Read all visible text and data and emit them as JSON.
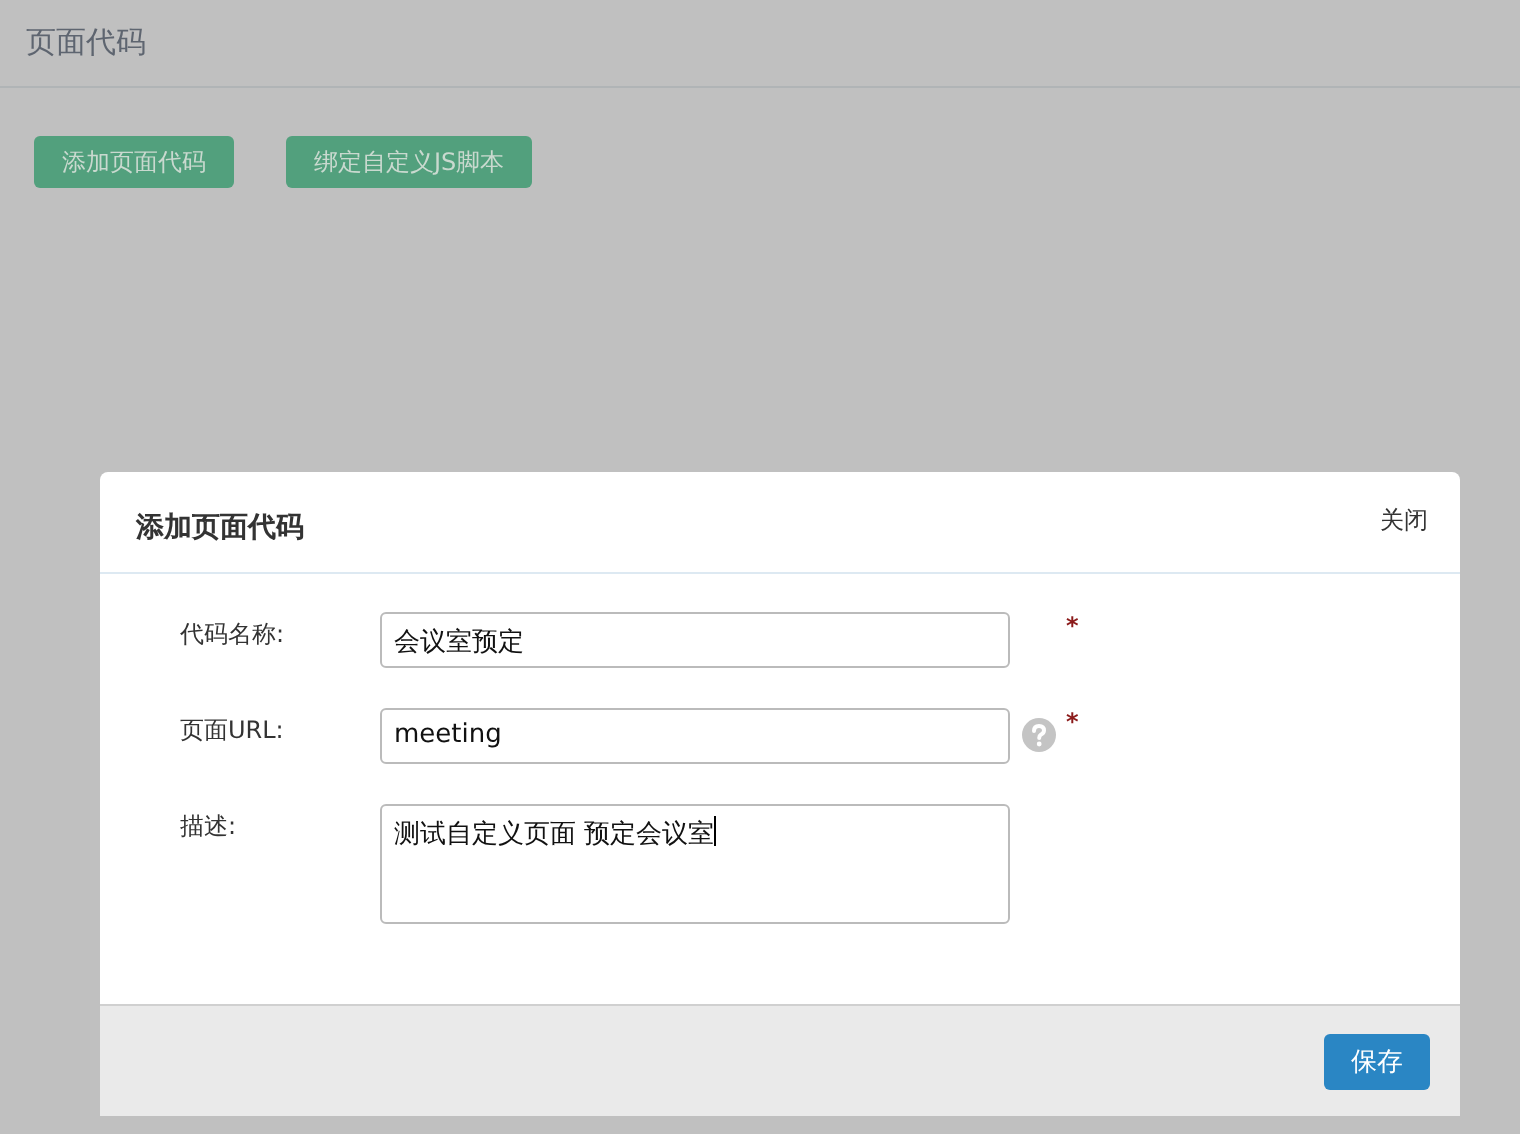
{
  "page": {
    "title": "页面代码",
    "buttons": [
      "添加页面代码",
      "绑定自定义JS脚本"
    ]
  },
  "dialog": {
    "title": "添加页面代码",
    "close": "关闭",
    "fields": [
      {
        "kind": "text",
        "label": "代码名称:",
        "value": "会议室预定",
        "help": false,
        "required_mark": "*"
      },
      {
        "kind": "text",
        "label": "页面URL:",
        "value": "meeting",
        "help": true,
        "required_mark": "*"
      },
      {
        "kind": "textarea",
        "label": "描述:",
        "value": "测试自定义页面 预定会议室",
        "help": false
      }
    ],
    "save": "保存"
  }
}
